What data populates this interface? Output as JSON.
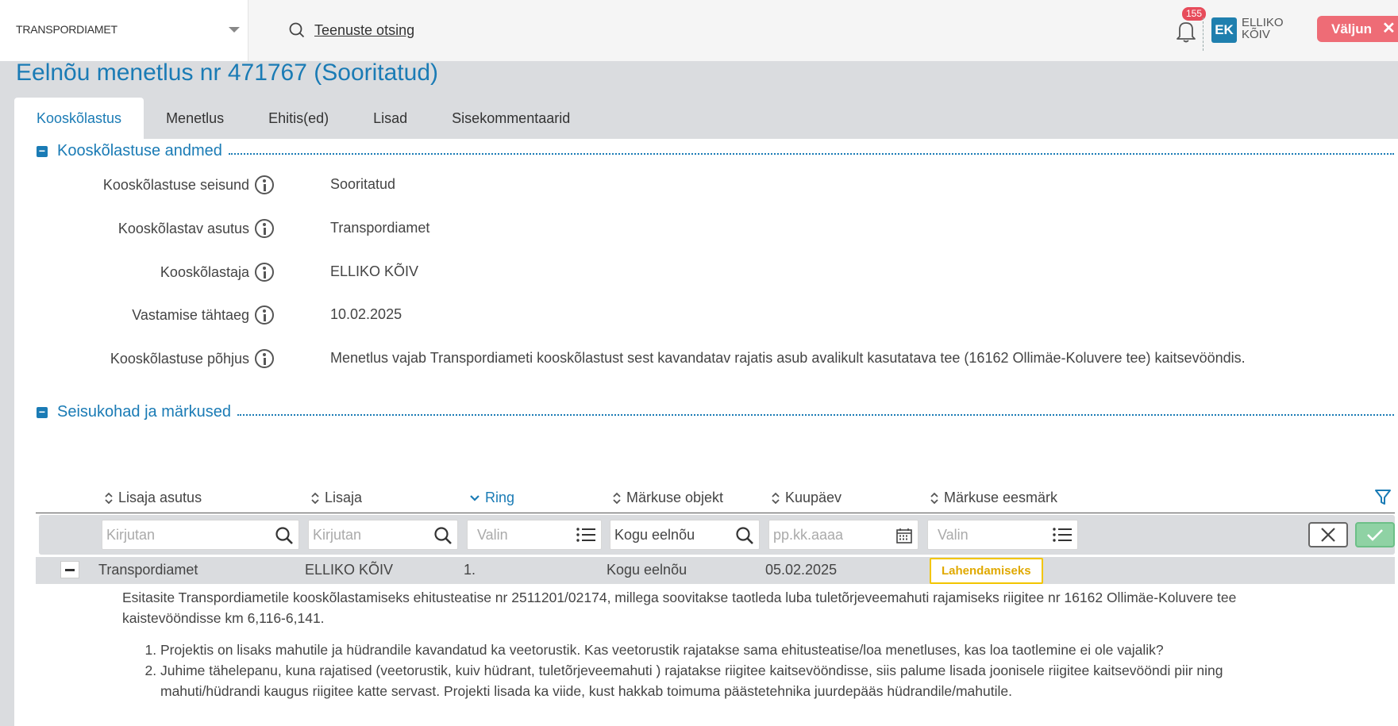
{
  "header": {
    "org": "TRANSPORDIAMET",
    "search_label": "Teenuste otsing",
    "notifications_count": "155",
    "avatar_initials": "EK",
    "user_first": "ELLIKO",
    "user_last": "KÕIV",
    "logout_label": "Väljun"
  },
  "page": {
    "title": "Eelnõu menetlus nr 471767 (Sooritatud)"
  },
  "tabs": [
    {
      "label": "Kooskõlastus",
      "active": true
    },
    {
      "label": "Menetlus"
    },
    {
      "label": "Ehitis(ed)"
    },
    {
      "label": "Lisad"
    },
    {
      "label": "Sisekommentaarid"
    }
  ],
  "section1": {
    "title": "Kooskõlastuse andmed",
    "fields": [
      {
        "label": "Kooskõlastuse seisund",
        "value": "Sooritatud"
      },
      {
        "label": "Kooskõlastav asutus",
        "value": "Transpordiamet"
      },
      {
        "label": "Kooskõlastaja",
        "value": "ELLIKO KÕIV"
      },
      {
        "label": "Vastamise tähtaeg",
        "value": "10.02.2025"
      },
      {
        "label": "Kooskõlastuse põhjus",
        "value": "Menetlus vajab Transpordiameti kooskõlastust sest kavandatav rajatis asub avalikult kasutatava tee (16162 Ollimäe-Koluvere tee) kaitsevööndis."
      }
    ]
  },
  "section2": {
    "title": "Seisukohad ja märkused",
    "columns": [
      "Lisaja asutus",
      "Lisaja",
      "Ring",
      "Märkuse objekt",
      "Kuupäev",
      "Märkuse eesmärk"
    ],
    "filters": {
      "lisaja_asutus_placeholder": "Kirjutan",
      "lisaja_placeholder": "Kirjutan",
      "ring_placeholder": "Valin",
      "objekt_value": "Kogu eelnõu",
      "kuupaev_placeholder": "pp.kk.aaaa",
      "eesmark_placeholder": "Valin"
    },
    "row": {
      "asutus": "Transpordiamet",
      "lisaja": "ELLIKO KÕIV",
      "ring": "1.",
      "objekt": "Kogu eelnõu",
      "kuupaev": "05.02.2025",
      "eesmark": "Lahendamiseks"
    },
    "remark_intro": "Esitasite Transpordiametile kooskõlastamiseks ehitusteatise nr 2511201/02174, millega soovitakse taotleda luba tuletõrjeveemahuti rajamiseks riigitee nr 16162 Ollimäe-Koluvere tee kaistevööndisse km 6,116-6,141.",
    "remark_points": [
      "Projektis on lisaks mahutile ja hüdrandile kavandatud ka veetorustik. Kas veetorustik rajatakse sama ehitusteatise/loa menetluses, kas loa taotlemine ei ole vajalik?",
      "Juhime tähelepanu, kuna rajatised (veetorustik, kuiv hüdrant, tuletõrjeveemahuti ) rajatakse riigitee kaitsevööndisse, siis palume lisada joonisele riigitee kaitsevööndi piir ning mahuti/hüdrandi kaugus riigitee katte servast. Projekti lisada ka viide, kust hakkab toimuma päästetehnika juurdepääs hüdrandile/mahutile."
    ]
  },
  "colors": {
    "accent": "#1a7bb5",
    "logout": "#ee6c76",
    "badge": "#e74c5b",
    "pill_border": "#f2c500"
  }
}
